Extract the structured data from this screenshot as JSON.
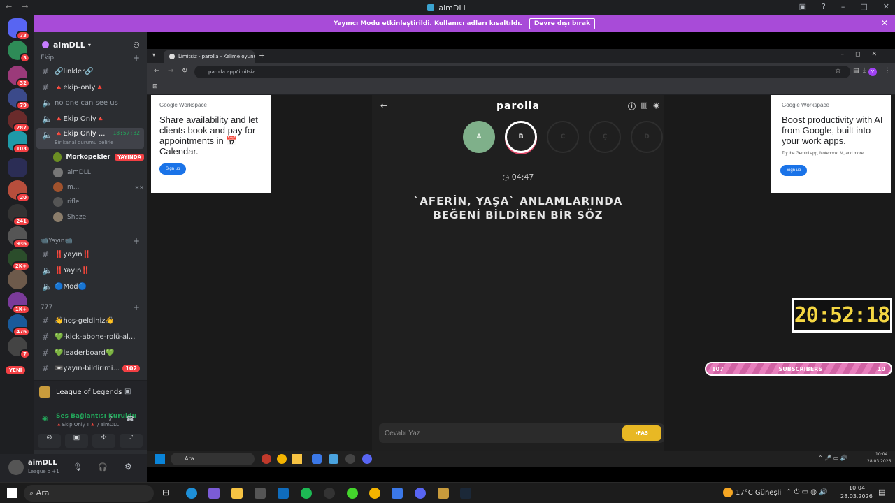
{
  "app": {
    "title": "aimDLL"
  },
  "stream_banner": {
    "text": "Yayıncı Modu etkinleştirildi. Kullanıcı adları kısaltıldı.",
    "button": "Devre dışı bırak"
  },
  "guilds": {
    "badges": [
      "73",
      "3",
      "32",
      "79",
      "287",
      "103",
      "20",
      "241",
      "936",
      "2K+",
      "1K+",
      "476",
      "7"
    ],
    "new_label": "YENİ"
  },
  "server": {
    "name": "aimDLL"
  },
  "categories": [
    "Ekip",
    "Yayın",
    "777"
  ],
  "category_yayin": "📹Yayın📹",
  "channels": [
    {
      "label": "🔗linkler🔗"
    },
    {
      "label": "🔺ekip-only🔺"
    },
    {
      "label": "no one can see us"
    },
    {
      "label": "🔺Ekip Only🔺"
    },
    {
      "label": "🔺Ekip Only ...",
      "time": "18:57:32",
      "status": "Bir kanal durumu belirle"
    }
  ],
  "voice_users": [
    {
      "name": "Morköpekler",
      "badge": "YAYINDA"
    },
    {
      "name": "aimDLL"
    },
    {
      "name": "m..."
    },
    {
      "name": "rifle"
    },
    {
      "name": "Shaze"
    }
  ],
  "yayin_channels": [
    "‼️yayın‼️",
    "‼️Yayın‼️",
    "🔵Mod🔵"
  ],
  "channels_777": [
    {
      "label": "👋hoş-geldiniz👋"
    },
    {
      "label": "💚-kick-abone-rolü-al..."
    },
    {
      "label": "💚leaderboard💚"
    },
    {
      "label": "📼yayın-bildirimi...",
      "badge": "102"
    }
  ],
  "activity": {
    "game": "League of Legends"
  },
  "voice": {
    "status": "Ses Bağlantısı Kuruldu",
    "channel": "🔺Ekip Only II🔺 / aimDLL"
  },
  "user": {
    "name": "aimDLL",
    "status": "League o +1"
  },
  "browser": {
    "tab_title": "Limitsiz - parolla - Kelime oyunu",
    "url": "parolla.app/limitsiz",
    "profile_initial": "Y"
  },
  "ad_left": {
    "brand": "Google Workspace",
    "text": "Share availability and let clients book and pay for appointments in 📅Calendar.",
    "button": "Sign up"
  },
  "ad_right": {
    "brand": "Google Workspace",
    "text": "Boost productivity with AI from Google, built into your work apps.",
    "subtext": "Try the Gemini app, NotebookLM, and more.",
    "button": "Sign up"
  },
  "game": {
    "title": "parolla",
    "letters": [
      "A",
      "B",
      "C",
      "Ç",
      "D"
    ],
    "timer": "04:47",
    "question": "`AFERİN, YAŞA` ANLAMLARINDA BEĞENİ BİLDİREN BİR SÖZ",
    "answer_placeholder": "Cevabı Yaz",
    "pass_button": "PAS"
  },
  "overlay": {
    "clock": "20:52:18",
    "subs_left": "107",
    "subs_label": "SUBSCRIBERS",
    "subs_right": "10"
  },
  "inner_taskbar": {
    "search": "Ara",
    "time": "10:04",
    "date": "28.03.2026"
  },
  "taskbar": {
    "search": "Ara",
    "weather": "17°C Güneşli",
    "time": "10:04",
    "date": "28.03.2026"
  },
  "colors": {
    "accent": "#a84bd8",
    "discord_red": "#f23f43",
    "green": "#23a55a",
    "pas": "#e8b824"
  }
}
